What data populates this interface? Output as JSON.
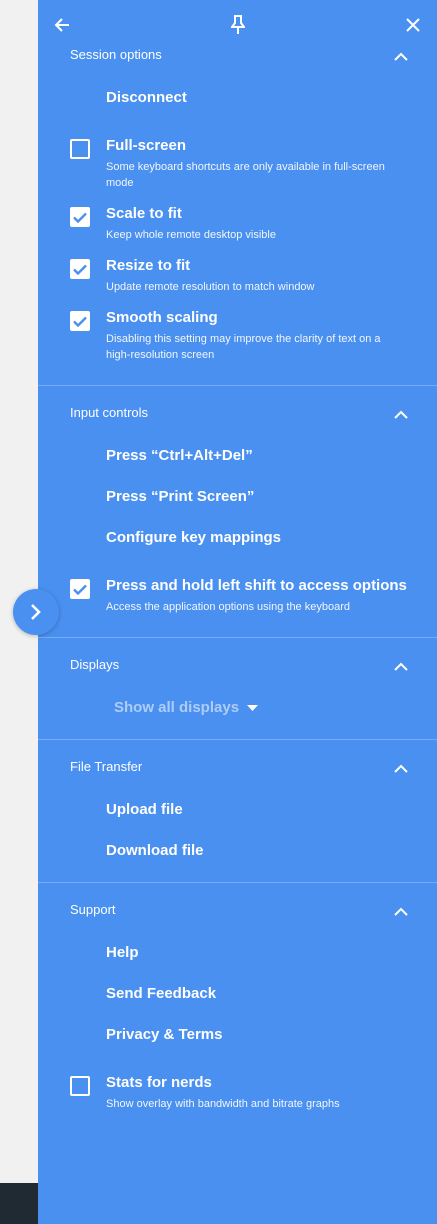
{
  "session": {
    "title": "Session options",
    "disconnect": "Disconnect",
    "fullscreen": {
      "label": "Full-screen",
      "desc": "Some keyboard shortcuts are only available in full-screen mode",
      "checked": false
    },
    "scale": {
      "label": "Scale to fit",
      "desc": "Keep whole remote desktop visible",
      "checked": true
    },
    "resize": {
      "label": "Resize to fit",
      "desc": "Update remote resolution to match window",
      "checked": true
    },
    "smooth": {
      "label": "Smooth scaling",
      "desc": "Disabling this setting may improve the clarity of text on a high-resolution screen",
      "checked": true
    }
  },
  "input": {
    "title": "Input controls",
    "cad": "Press “Ctrl+Alt+Del”",
    "printscreen": "Press “Print Screen”",
    "keymap": "Configure key mappings",
    "shift": {
      "label": "Press and hold left shift to access options",
      "desc": "Access the application options using the keyboard",
      "checked": true
    }
  },
  "displays": {
    "title": "Displays",
    "select": "Show all displays"
  },
  "files": {
    "title": "File Transfer",
    "upload": "Upload file",
    "download": "Download file"
  },
  "support": {
    "title": "Support",
    "help": "Help",
    "feedback": "Send Feedback",
    "privacy": "Privacy & Terms",
    "stats": {
      "label": "Stats for nerds",
      "desc": "Show overlay with bandwidth and bitrate graphs",
      "checked": false
    }
  },
  "icons": {
    "back": "arrow-left-icon",
    "pin": "pin-icon",
    "close": "close-icon",
    "collapse": "chevron-up-icon",
    "expand": "chevron-right-icon",
    "check": "check-icon",
    "dropdown": "caret-down-icon"
  }
}
